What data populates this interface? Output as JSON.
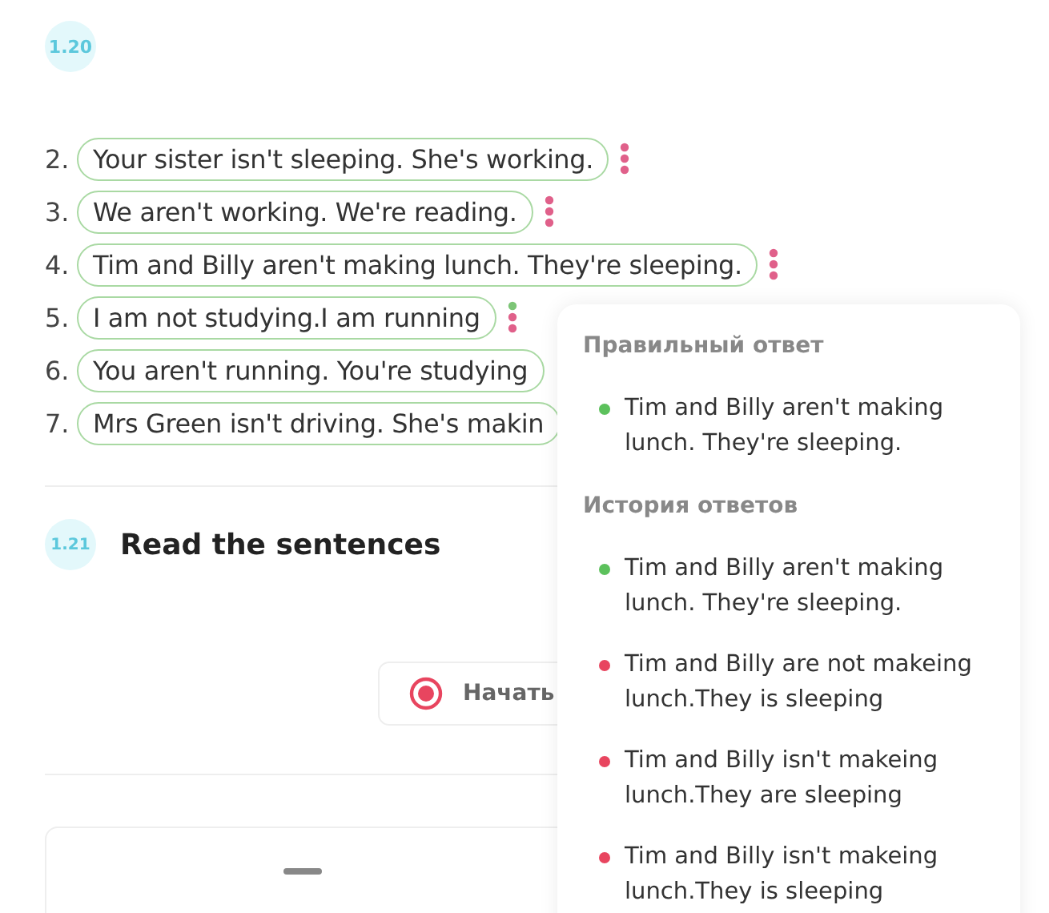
{
  "exercise_1_20": {
    "number": "1.20",
    "answers": [
      {
        "index": "2.",
        "text": "Your sister isn't sleeping. She's working.",
        "marks": [
          {
            "color": "#e0608a"
          },
          {
            "color": "#e0608a"
          },
          {
            "color": "#e0608a"
          }
        ]
      },
      {
        "index": "3.",
        "text": "We aren't working. We're reading.",
        "marks": [
          {
            "color": "#e0608a"
          },
          {
            "color": "#e0608a"
          },
          {
            "color": "#e0608a"
          }
        ]
      },
      {
        "index": "4.",
        "text": "Tim and Billy aren't making lunch. They're sleeping.",
        "marks": [
          {
            "color": "#e0608a"
          },
          {
            "color": "#e0608a"
          },
          {
            "color": "#e0608a"
          }
        ]
      },
      {
        "index": "5.",
        "text": "I am not studying.I am running",
        "marks": [
          {
            "color": "#7cc576"
          },
          {
            "color": "#e0608a"
          },
          {
            "color": "#e0608a"
          }
        ]
      },
      {
        "index": "6.",
        "text": "You aren't running. You're studying"
      },
      {
        "index": "7.",
        "text": "Mrs Green isn't driving. She's makin"
      }
    ]
  },
  "exercise_1_21": {
    "number": "1.21",
    "title": "Read the sentences",
    "start_button": "Начать"
  },
  "popover": {
    "correct_heading": "Правильный ответ",
    "correct": [
      {
        "text": "Tim and Billy aren't making lunch. They're sleeping.",
        "color": "#5cc15c"
      }
    ],
    "history_heading": "История ответов",
    "history": [
      {
        "text": "Tim and Billy aren't making lunch. They're sleeping.",
        "color": "#5cc15c"
      },
      {
        "text": "Tim and Billy are not makeing lunch.They is sleeping",
        "color": "#e8455f"
      },
      {
        "text": "Tim and Billy isn't makeing lunch.They are sleeping",
        "color": "#e8455f"
      },
      {
        "text": "Tim and Billy isn't makeing lunch.They is sleeping",
        "color": "#e8455f"
      }
    ]
  }
}
